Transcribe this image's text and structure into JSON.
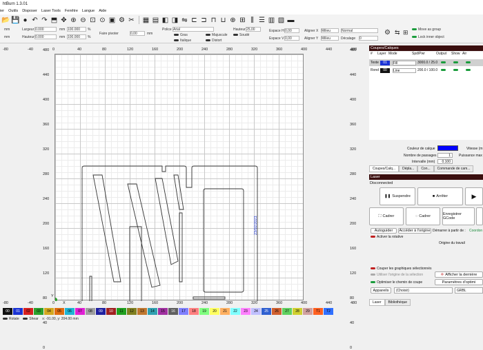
{
  "app_title": "htBurn 1.3.01",
  "menu": [
    "ier",
    "Outils",
    "Disposer",
    "Laser Tools",
    "Fenêtre",
    "Langue",
    "Aide"
  ],
  "toolbar_icons": [
    "folder-open-icon",
    "save-icon",
    "circle-icon",
    "undo-icon",
    "redo-icon",
    "import-icon",
    "move-icon",
    "zoom-in-icon",
    "zoom-out-icon",
    "zoom-frame-icon",
    "zoom-selection-icon",
    "camera-icon",
    "settings-icon",
    "tools-icon"
  ],
  "propbar": {
    "mm1": "mm",
    "mm2": "mm",
    "largeur_label": "Largeur",
    "largeur_val": "0.000",
    "hauteur_label": "Hauteur",
    "hauteur_val": "0.000",
    "mm3": "mm",
    "mm4": "mm",
    "pct1": "100.000",
    "pct2": "100.000",
    "pct_sign1": "%",
    "pct_sign2": "%",
    "rotate_label": "Faire pivoter",
    "rotate_val": "0,00",
    "rotate_unit": "mm",
    "police_label": "Police",
    "police_val": "Arial",
    "hauteur2_label": "Hauteur",
    "hauteur2_val": "25,00",
    "gras": "Gras",
    "majuscule": "Majuscule",
    "soude": "Soudé",
    "italique": "Italique",
    "distort": "Distort",
    "espace_h": "Espace H",
    "espace_h_val": "0,00",
    "espace_v": "Espace V",
    "espace_v_val": "0,00",
    "aligner_x": "Aligner X",
    "aligner_x_val": "Milieu",
    "aligner_y": "Aligner Y",
    "aligner_y_val": "Milieu",
    "normal": "Normal",
    "decalage": "Décalage",
    "decalage_val": "0",
    "move_group": "Move as group",
    "lock_inner": "Lock inner object"
  },
  "ruler_top": [
    "-80",
    "-40",
    "0",
    "40",
    "80",
    "120",
    "160",
    "200",
    "240",
    "280",
    "320",
    "360",
    "400",
    "440",
    "480"
  ],
  "ruler_bottom": [
    "-80",
    "-40",
    "0",
    "40",
    "80",
    "120",
    "160",
    "200",
    "240",
    "280",
    "320",
    "360",
    "400",
    "440",
    "480"
  ],
  "ruler_left": [
    "480",
    "440",
    "400",
    "360",
    "320",
    "280",
    "240",
    "200",
    "160",
    "120",
    "80",
    "40",
    "0"
  ],
  "ruler_right": [
    "480",
    "440",
    "400",
    "360",
    "320",
    "280",
    "240",
    "200",
    "160",
    "120",
    "80",
    "40",
    "0"
  ],
  "axis_x": "X",
  "axis_y": "Y",
  "canvas_text": "23/02/2023",
  "panel": {
    "cuts_header": "Coupes/Calques",
    "cols": [
      "#",
      "Layer",
      "Mode",
      "Spd/Pwr",
      "Output",
      "Show",
      "Air"
    ],
    "rows": [
      {
        "name": "Texte",
        "layer": "01",
        "mode": "Fill",
        "spdpwr": "3000.0 / 25.0",
        "color": "#1a33d4"
      },
      {
        "name": "Rond",
        "layer": "00",
        "mode": "Line",
        "spdpwr": "200.0 / 100.0",
        "color": "#111111"
      }
    ],
    "couleur_label": "Couleur de calque",
    "couleur_val": "#0000ff",
    "vitesse_label": "Vitesse (m",
    "passages_label": "Nombre de passages",
    "passages_val": "1",
    "puissance_label": "Puissance max",
    "intervalle_label": "Intervalle (mm)",
    "intervalle_val": "0.100",
    "tabs1": [
      "Coupes/Calq...",
      "Dépla...",
      "Con...",
      "Commande de cam..."
    ],
    "laser_header": "Laser",
    "status": "Disconnected",
    "suspend": "Suspendre",
    "stop": "Arrêter",
    "cadrer1": "Cadrer",
    "cadrer2": "Cadrer",
    "save_gcode": "Enregistrer GCode",
    "autoguider": "Autoguider",
    "acceder": "Accéder à l'origine",
    "demarrer": "Démarrer à partir de :",
    "coord": "Coordon",
    "rotative": "Activer la rotative",
    "origine": "Origine du travail",
    "couper_sel": "Couper les graphiques sélectionnés",
    "afficher": "Afficher la dernière",
    "utiliser_origine": "Utiliser l'origine de la sélection",
    "optimiser": "Optimiser le chemin de coupe",
    "parametres": "Paramètres d'optimi",
    "appareils": "Appareils",
    "choisir": "(Choisir)",
    "grbl": "GRBL",
    "tabs2": [
      "Laser",
      "Bibliothèque"
    ]
  },
  "palette": [
    {
      "l": "00",
      "c": "#111111"
    },
    {
      "l": "01",
      "c": "#1a33d4"
    },
    {
      "l": "02",
      "c": "#d62020"
    },
    {
      "l": "03",
      "c": "#2ca02c"
    },
    {
      "l": "04",
      "c": "#d4a820"
    },
    {
      "l": "05",
      "c": "#e06c10"
    },
    {
      "l": "06",
      "c": "#20b4d4"
    },
    {
      "l": "07",
      "c": "#e020d4"
    },
    {
      "l": "08",
      "c": "#a0a0a0"
    },
    {
      "l": "09",
      "c": "#2020a0"
    },
    {
      "l": "10",
      "c": "#a02020"
    },
    {
      "l": "11",
      "c": "#20a020"
    },
    {
      "l": "12",
      "c": "#808020"
    },
    {
      "l": "13",
      "c": "#c07830"
    },
    {
      "l": "14",
      "c": "#30a0b0"
    },
    {
      "l": "15",
      "c": "#a030a0"
    },
    {
      "l": "16",
      "c": "#606060"
    },
    {
      "l": "17",
      "c": "#8080ff"
    },
    {
      "l": "18",
      "c": "#ff8080"
    },
    {
      "l": "19",
      "c": "#80ff80"
    },
    {
      "l": "20",
      "c": "#ffff60"
    },
    {
      "l": "21",
      "c": "#ffb060"
    },
    {
      "l": "22",
      "c": "#80ffff"
    },
    {
      "l": "23",
      "c": "#ff80ff"
    },
    {
      "l": "24",
      "c": "#c0c0ff"
    },
    {
      "l": "25",
      "c": "#3060d0"
    },
    {
      "l": "26",
      "c": "#d06030"
    },
    {
      "l": "27",
      "c": "#60d060"
    },
    {
      "l": "28",
      "c": "#d0d030"
    },
    {
      "l": "29",
      "c": "#d0a0a0"
    },
    {
      "l": "T1",
      "c": "#ff6020"
    },
    {
      "l": "T2",
      "c": "#3070ff"
    }
  ],
  "status_bar": {
    "rotate": "Rotate",
    "shear": "Shear",
    "coords": "x: -91.00, y: 204.00 mm"
  }
}
